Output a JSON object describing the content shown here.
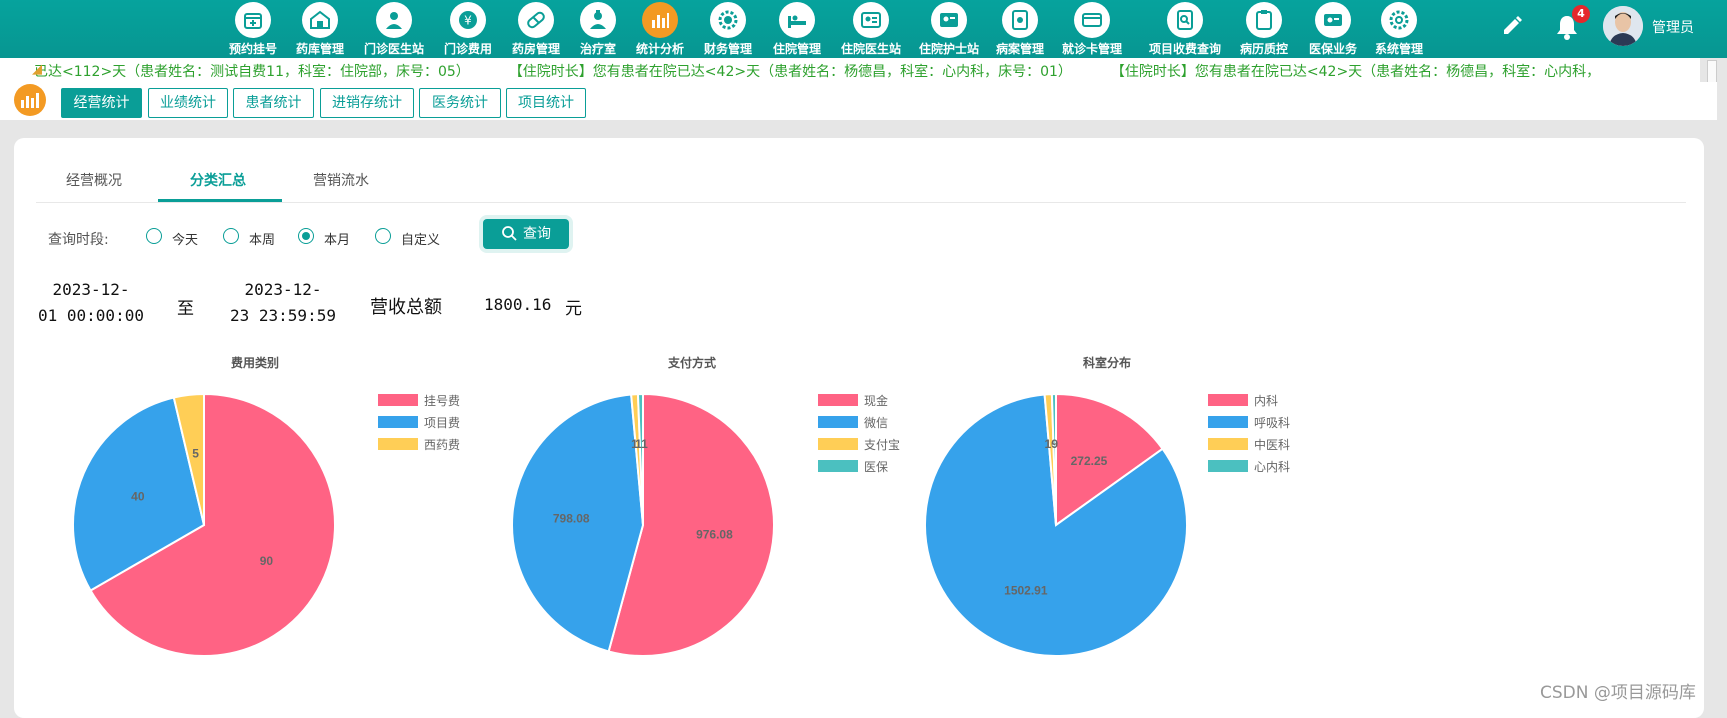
{
  "nav": {
    "items": [
      {
        "label": "预约挂号",
        "icon": "calendar-icon"
      },
      {
        "label": "药库管理",
        "icon": "warehouse-icon"
      },
      {
        "label": "门诊医生站",
        "icon": "doctor-icon"
      },
      {
        "label": "门诊费用",
        "icon": "yen-icon"
      },
      {
        "label": "药房管理",
        "icon": "pill-icon"
      },
      {
        "label": "治疗室",
        "icon": "nurse-icon"
      },
      {
        "label": "统计分析",
        "icon": "bar-chart-icon"
      },
      {
        "label": "财务管理",
        "icon": "gear-coin-icon"
      },
      {
        "label": "住院管理",
        "icon": "hospital-bed-icon"
      },
      {
        "label": "住院医生站",
        "icon": "doctor-card-icon"
      },
      {
        "label": "住院护士站",
        "icon": "nurse-card-icon"
      },
      {
        "label": "病案管理",
        "icon": "medical-record-icon"
      },
      {
        "label": "就诊卡管理",
        "icon": "card-icon"
      },
      {
        "label": "项目收费查询",
        "icon": "search-document-icon"
      },
      {
        "label": "病历质控",
        "icon": "clipboard-icon"
      },
      {
        "label": "医保业务",
        "icon": "insurance-card-icon"
      },
      {
        "label": "系统管理",
        "icon": "settings-icon"
      }
    ],
    "active_index": 6,
    "notification_count": "4",
    "user_name": "管理员"
  },
  "marquee": {
    "items": [
      "已达<112>天（患者姓名：测试自费11，科室：住院部，床号：05）",
      "【住院时长】您有患者在院已达<42>天（患者姓名：杨德昌，科室：心内科，床号：01）",
      "【住院时长】您有患者在院已达<42>天（患者姓名：杨德昌，科室：心内科，"
    ]
  },
  "subtabs": {
    "items": [
      "经营统计",
      "业绩统计",
      "患者统计",
      "进销存统计",
      "医务统计",
      "项目统计"
    ],
    "active_index": 0
  },
  "panel": {
    "tabs": [
      "经营概况",
      "分类汇总",
      "营销流水"
    ],
    "active_tab": 1,
    "query_label": "查询时段:",
    "periods": [
      "今天",
      "本周",
      "本月",
      "自定义"
    ],
    "selected_period": 2,
    "query_button": "查询",
    "start_date_line1": "2023-12-",
    "start_date_line2": "01 00:00:00",
    "to_label": "至",
    "end_date_line1": "2023-12-",
    "end_date_line2": "23 23:59:59",
    "revenue_label": "营收总额",
    "revenue_value": "1800.16",
    "revenue_unit": "元"
  },
  "colors": {
    "teal": "#0a9e97",
    "red": "#ff6384",
    "blue": "#36a2eb",
    "yellow": "#ffce56",
    "cyan": "#4bc0c0"
  },
  "chart_data": [
    {
      "type": "pie",
      "title": "费用类别",
      "categories": [
        "挂号费",
        "项目费",
        "西药费"
      ],
      "values": [
        90,
        40,
        5
      ],
      "legend": "right"
    },
    {
      "type": "pie",
      "title": "支付方式",
      "categories": [
        "现金",
        "微信",
        "支付宝",
        "医保"
      ],
      "values": [
        976.08,
        798.08,
        15,
        11
      ],
      "legend": "right"
    },
    {
      "type": "pie",
      "title": "科室分布",
      "categories": [
        "内科",
        "呼吸科",
        "中医科",
        "心内科"
      ],
      "values": [
        272.25,
        1502.91,
        16,
        9
      ],
      "legend": "right"
    }
  ],
  "watermark": "CSDN @项目源码库"
}
